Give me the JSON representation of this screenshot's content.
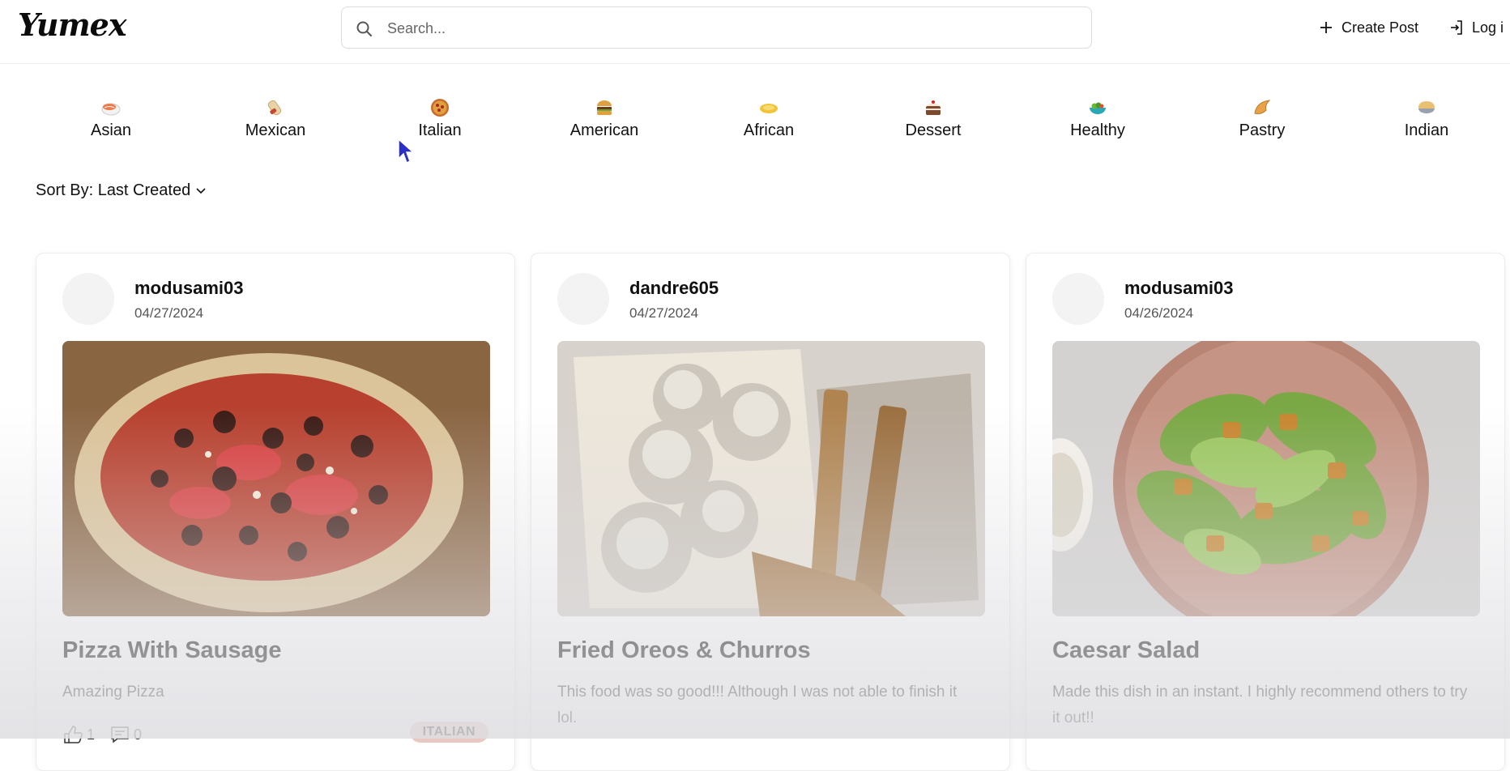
{
  "app": {
    "logo": "Yumex"
  },
  "search": {
    "placeholder": "Search..."
  },
  "header": {
    "create_post_label": "Create Post",
    "login_label": "Log i"
  },
  "categories": [
    {
      "label": "Asian",
      "icon": "sushi-icon"
    },
    {
      "label": "Mexican",
      "icon": "burrito-icon"
    },
    {
      "label": "Italian",
      "icon": "pizza-icon"
    },
    {
      "label": "American",
      "icon": "burger-icon"
    },
    {
      "label": "African",
      "icon": "flatbread-icon"
    },
    {
      "label": "Dessert",
      "icon": "cake-icon"
    },
    {
      "label": "Healthy",
      "icon": "salad-bowl-icon"
    },
    {
      "label": "Pastry",
      "icon": "croissant-icon"
    },
    {
      "label": "Indian",
      "icon": "curry-icon"
    }
  ],
  "sort": {
    "label": "Sort By: Last Created"
  },
  "posts": [
    {
      "username": "modusami03",
      "date": "04/27/2024",
      "title": "Pizza With Sausage",
      "description": "Amazing Pizza",
      "likes": "1",
      "comments": "0",
      "tag": "ITALIAN"
    },
    {
      "username": "dandre605",
      "date": "04/27/2024",
      "title": "Fried Oreos & Churros",
      "description": "This food was so good!!! Although I was not able to finish it lol."
    },
    {
      "username": "modusami03",
      "date": "04/26/2024",
      "title": "Caesar Salad",
      "description": "Made this dish in an instant. I highly recommend others to try it out!!"
    }
  ]
}
